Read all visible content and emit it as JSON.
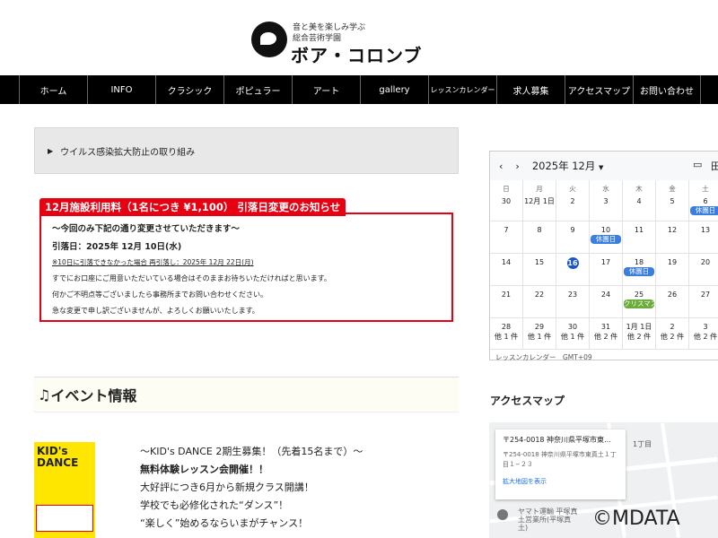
{
  "logo": {
    "tagline1": "音と美を楽しみ学ぶ",
    "tagline2": "総合芸術学園",
    "name": "ボア・コロンブ"
  },
  "nav": [
    "ホーム",
    "INFO",
    "クラシック",
    "ポピュラー",
    "アート",
    "gallery",
    "レッスンカレンダー",
    "求人募集",
    "アクセスマップ",
    "お問い合わせ"
  ],
  "virus": {
    "label": "ウイルス感染拡大防止の取り組み"
  },
  "notice": {
    "title": "12月施設利用料（1名につき ¥1,100） 引落日変更のお知らせ",
    "lines": [
      "〜今回のみ下記の通り変更させていただきます〜",
      "引落日：2025年 12月 10日(水)",
      "※10日に引落できなかった場合 再引落し：2025年 12月 22日(月)",
      "すでにお口座にご用意いただいている場合はそのままお待ちいただければと思います。",
      "何かご不明点等ございましたら事務所までお問い合わせください。",
      "急な変更で申し訳ございませんが、よろしくお願いいたします。"
    ]
  },
  "events": {
    "heading": "イベント情報",
    "poster": "KID's DANCE",
    "lines": [
      "〜KID's DANCE 2期生募集！（先着15名まで）〜",
      "無料体験レッスン会開催！！",
      "大好評につき6月から新規クラス開講！",
      "学校でも必修化された“ダンス”！",
      "“楽しく”始めるならいまがチャンス！"
    ]
  },
  "calendar": {
    "title": "2025年 12月",
    "dow": [
      "日",
      "月",
      "火",
      "水",
      "木",
      "金",
      "土"
    ],
    "days": [
      [
        "30",
        ""
      ],
      [
        "12月 1日",
        ""
      ],
      [
        "2",
        ""
      ],
      [
        "3",
        ""
      ],
      [
        "4",
        ""
      ],
      [
        "5",
        ""
      ],
      [
        "6",
        "休園日"
      ],
      [
        "7",
        ""
      ],
      [
        "8",
        ""
      ],
      [
        "9",
        ""
      ],
      [
        "10",
        "休園日"
      ],
      [
        "11",
        ""
      ],
      [
        "12",
        ""
      ],
      [
        "13",
        ""
      ],
      [
        "14",
        ""
      ],
      [
        "15",
        ""
      ],
      [
        "16",
        ""
      ],
      [
        "17",
        ""
      ],
      [
        "18",
        "休園日"
      ],
      [
        "19",
        ""
      ],
      [
        "20",
        ""
      ],
      [
        "21",
        ""
      ],
      [
        "22",
        ""
      ],
      [
        "23",
        ""
      ],
      [
        "24",
        ""
      ],
      [
        "25",
        "クリスマス"
      ],
      [
        "26",
        ""
      ],
      [
        "27",
        ""
      ],
      [
        "28",
        "他 1 件"
      ],
      [
        "29",
        "他 1 件"
      ],
      [
        "30",
        "他 1 件"
      ],
      [
        "31",
        "他 2 件"
      ],
      [
        "1月 1日",
        "他 2 件"
      ],
      [
        "2",
        "他 2 件"
      ],
      [
        "3",
        "他 2 件"
      ]
    ],
    "today": "16",
    "footer": "レッスンカレンダー　GMT+09"
  },
  "access": {
    "heading": "アクセスマップ",
    "popup_title": "〒254-0018 神奈川県平塚市東…",
    "address": "〒254-0018 神奈川県平塚市東真土１丁目１−２３",
    "link": "拡大地図を表示",
    "place": "ヤマト運輸 平塚真土営業所(平塚真土)",
    "street": "1丁目",
    "copyright": "©MDATA"
  }
}
